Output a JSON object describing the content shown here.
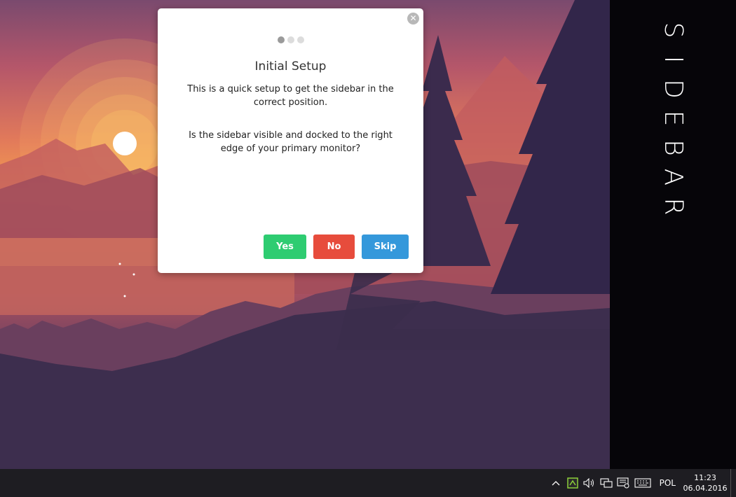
{
  "sidebar": {
    "title_letters": [
      "S",
      "I",
      "D",
      "E",
      "B",
      "A",
      "R"
    ]
  },
  "dialog": {
    "title": "Initial Setup",
    "intro": "This is a quick setup to get the sidebar in the correct position.",
    "question": "Is the sidebar visible and docked to the right edge of your primary monitor?",
    "step": {
      "current": 1,
      "total": 3
    },
    "buttons": {
      "yes": "Yes",
      "no": "No",
      "skip": "Skip"
    },
    "button_colors": {
      "yes": "#2ecc71",
      "no": "#e74c3c",
      "skip": "#3498db"
    }
  },
  "taskbar": {
    "tray_icons": [
      "chevron-up-icon",
      "app-icon",
      "volume-icon",
      "network-icon",
      "action-center-icon",
      "keyboard-icon"
    ],
    "language": "POL",
    "time": "11:23",
    "date": "06.04.2016"
  }
}
